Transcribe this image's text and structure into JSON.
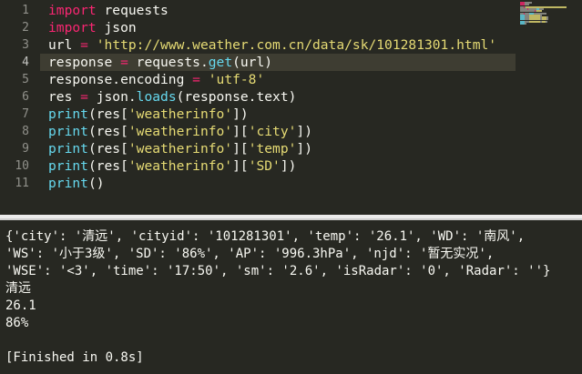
{
  "editor": {
    "line_numbers": [
      "1",
      "2",
      "3",
      "4",
      "5",
      "6",
      "7",
      "8",
      "9",
      "10",
      "11"
    ],
    "lines": [
      [
        {
          "t": "import",
          "c": "kw"
        },
        {
          "t": " requests",
          "c": ""
        }
      ],
      [
        {
          "t": "import",
          "c": "kw"
        },
        {
          "t": " json",
          "c": ""
        }
      ],
      [
        {
          "t": "url ",
          "c": ""
        },
        {
          "t": "=",
          "c": "op"
        },
        {
          "t": " ",
          "c": ""
        },
        {
          "t": "'http://www.weather.com.cn/data/sk/101281301.html'",
          "c": "str"
        }
      ],
      [
        {
          "t": "response ",
          "c": ""
        },
        {
          "t": "=",
          "c": "op"
        },
        {
          "t": " requests.",
          "c": ""
        },
        {
          "t": "get",
          "c": "fn"
        },
        {
          "t": "(url)",
          "c": ""
        }
      ],
      [
        {
          "t": "response.encoding ",
          "c": ""
        },
        {
          "t": "=",
          "c": "op"
        },
        {
          "t": " ",
          "c": ""
        },
        {
          "t": "'utf-8'",
          "c": "str"
        }
      ],
      [
        {
          "t": "res ",
          "c": ""
        },
        {
          "t": "=",
          "c": "op"
        },
        {
          "t": " json.",
          "c": ""
        },
        {
          "t": "loads",
          "c": "fn"
        },
        {
          "t": "(response.text)",
          "c": ""
        }
      ],
      [
        {
          "t": "print",
          "c": "fn"
        },
        {
          "t": "(res[",
          "c": ""
        },
        {
          "t": "'weatherinfo'",
          "c": "str"
        },
        {
          "t": "])",
          "c": ""
        }
      ],
      [
        {
          "t": "print",
          "c": "fn"
        },
        {
          "t": "(res[",
          "c": ""
        },
        {
          "t": "'weatherinfo'",
          "c": "str"
        },
        {
          "t": "][",
          "c": ""
        },
        {
          "t": "'city'",
          "c": "str"
        },
        {
          "t": "])",
          "c": ""
        }
      ],
      [
        {
          "t": "print",
          "c": "fn"
        },
        {
          "t": "(res[",
          "c": ""
        },
        {
          "t": "'weatherinfo'",
          "c": "str"
        },
        {
          "t": "][",
          "c": ""
        },
        {
          "t": "'temp'",
          "c": "str"
        },
        {
          "t": "])",
          "c": ""
        }
      ],
      [
        {
          "t": "print",
          "c": "fn"
        },
        {
          "t": "(res[",
          "c": ""
        },
        {
          "t": "'weatherinfo'",
          "c": "str"
        },
        {
          "t": "][",
          "c": ""
        },
        {
          "t": "'SD'",
          "c": "str"
        },
        {
          "t": "])",
          "c": ""
        }
      ],
      [
        {
          "t": "print",
          "c": "fn"
        },
        {
          "t": "()",
          "c": ""
        }
      ]
    ]
  },
  "output": {
    "lines": [
      "{'city': '清远', 'cityid': '101281301', 'temp': '26.1', 'WD': '南风',",
      "'WS': '小于3级', 'SD': '86%', 'AP': '996.3hPa', 'njd': '暂无实况',",
      "'WSE': '<3', 'time': '17:50', 'sm': '2.6', 'isRadar': '0', 'Radar': ''}",
      "清远",
      "26.1",
      "86%",
      "",
      "[Finished in 0.8s]"
    ]
  },
  "colors": {
    "background": "#272822",
    "keyword": "#f92672",
    "string": "#e6db74",
    "function": "#66d9ef",
    "text": "#f8f8f2"
  }
}
